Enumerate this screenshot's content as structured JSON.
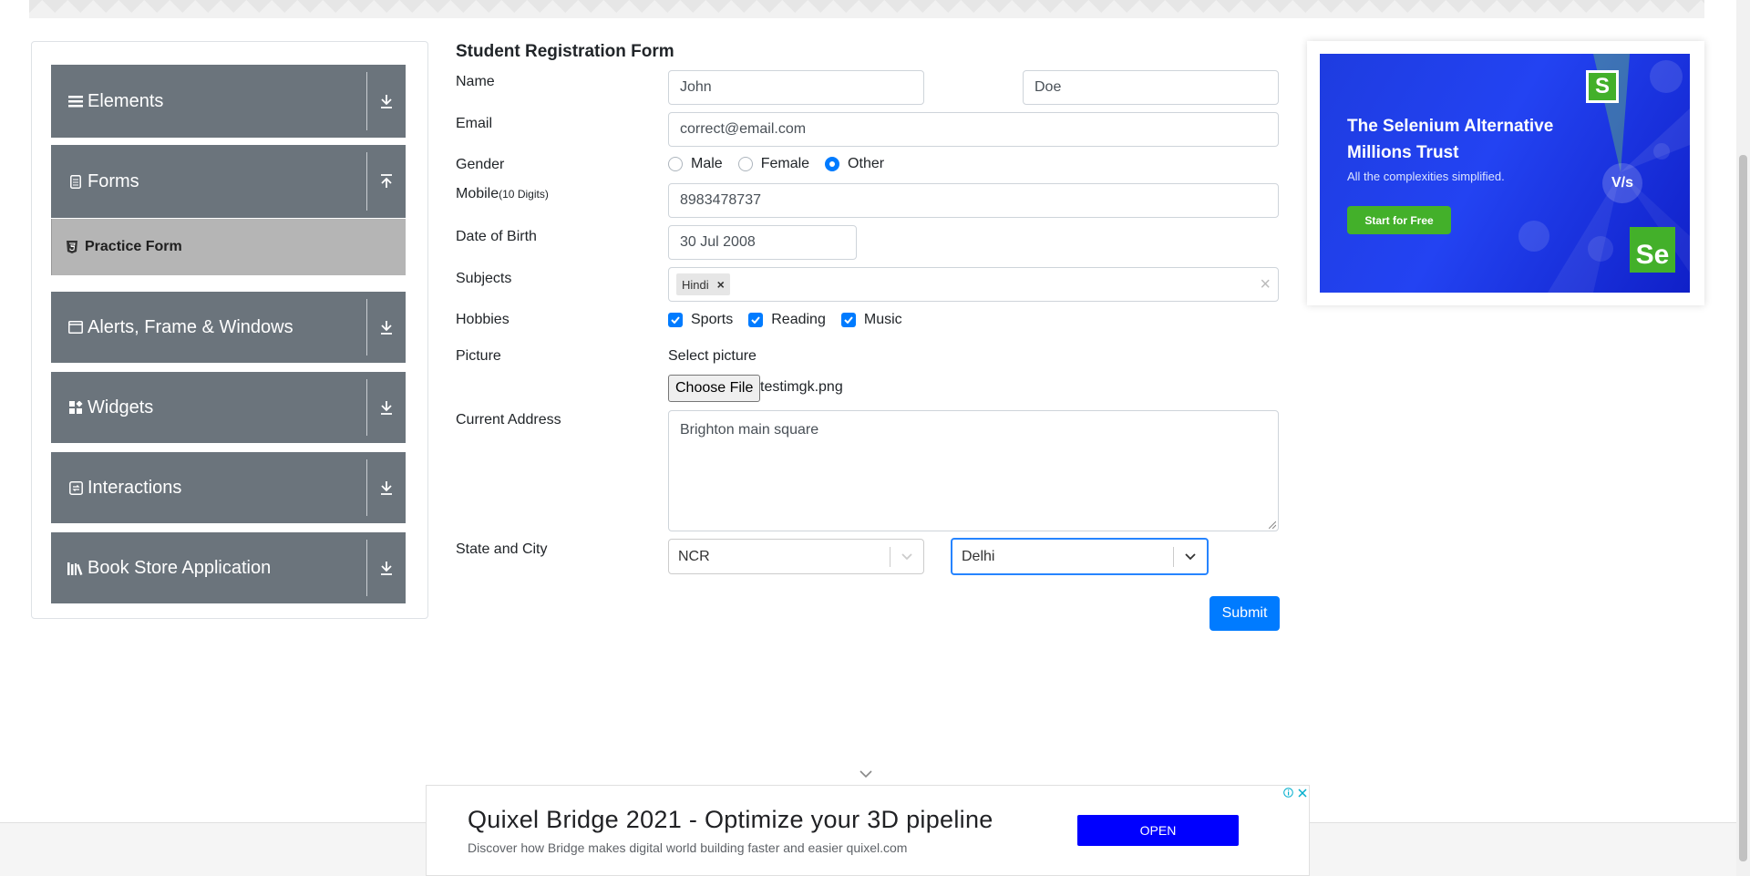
{
  "sidebar": {
    "groups": [
      {
        "label": "Elements",
        "icon": "menu-icon",
        "toggle": "download-icon"
      },
      {
        "label": "Forms",
        "icon": "document-icon",
        "toggle": "upload-icon"
      },
      {
        "label": "Alerts, Frame & Windows",
        "icon": "window-icon",
        "toggle": "download-icon"
      },
      {
        "label": "Widgets",
        "icon": "widgets-icon",
        "toggle": "download-icon"
      },
      {
        "label": "Interactions",
        "icon": "interactions-icon",
        "toggle": "download-icon"
      },
      {
        "label": "Book Store Application",
        "icon": "books-icon",
        "toggle": "download-icon"
      }
    ],
    "active_item": {
      "label": "Practice Form",
      "icon": "html5-icon"
    }
  },
  "form": {
    "title": "Student Registration Form",
    "name": {
      "label": "Name",
      "first": "John",
      "last": "Doe"
    },
    "email": {
      "label": "Email",
      "value": "correct@email.com"
    },
    "gender": {
      "label": "Gender",
      "options": [
        "Male",
        "Female",
        "Other"
      ],
      "selected": "Other"
    },
    "mobile": {
      "label": "Mobile",
      "hint": "(10 Digits)",
      "value": "8983478737"
    },
    "dob": {
      "label": "Date of Birth",
      "value": "30 Jul 2008"
    },
    "subjects": {
      "label": "Subjects",
      "chips": [
        "Hindi"
      ],
      "clear": "×",
      "chip_remove": "×"
    },
    "hobbies": {
      "label": "Hobbies",
      "options": [
        "Sports",
        "Reading",
        "Music"
      ],
      "checked": [
        "Sports",
        "Reading",
        "Music"
      ]
    },
    "picture": {
      "label": "Picture",
      "select_label": "Select picture",
      "button": "Choose File",
      "filename": "testimgk.png"
    },
    "address": {
      "label": "Current Address",
      "value": "Brighton main square"
    },
    "state_city": {
      "label": "State and City",
      "state": "NCR",
      "city": "Delhi"
    },
    "submit": "Submit"
  },
  "right_ad": {
    "title": "The Selenium Alternative Millions Trust",
    "subtitle": "All the complexities simplified.",
    "cta": "Start for Free",
    "badge_s": "S",
    "badge_se": "Se",
    "badge_vs": "V/s"
  },
  "bottom_ad": {
    "headline": "Quixel Bridge 2021 - Optimize your 3D pipeline",
    "description": "Discover how Bridge makes digital world building faster and easier quixel.com",
    "button": "OPEN"
  },
  "colors": {
    "sidebar_bg": "#6b747c",
    "active_item_bg": "#b5b5b5",
    "primary": "#007bff",
    "ad_green": "#43b02a",
    "ad_blue": "#0000ff"
  }
}
